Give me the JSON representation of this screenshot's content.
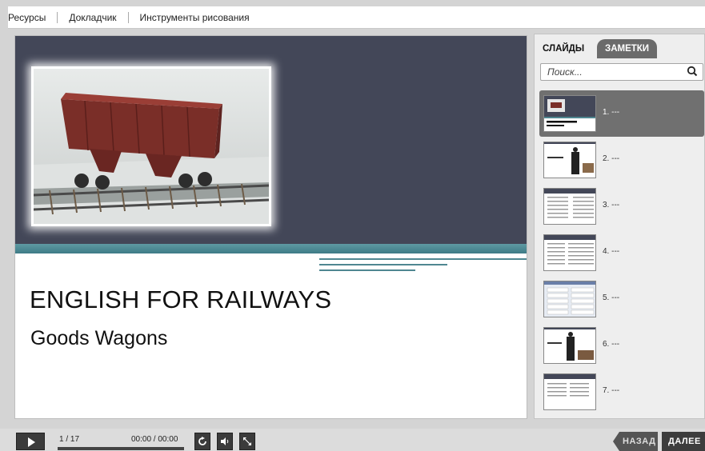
{
  "menu": {
    "items": [
      {
        "label": "Ресурсы"
      },
      {
        "label": "Докладчик"
      },
      {
        "label": "Инструменты рисования"
      }
    ]
  },
  "slide": {
    "title": "ENGLISH FOR RAILWAYS",
    "subtitle": "Goods Wagons"
  },
  "panel": {
    "tab_slides": "СЛАЙДЫ",
    "tab_notes": "ЗАМЕТКИ",
    "search_placeholder": "Поиск...",
    "slides": [
      {
        "label": "1. ---",
        "active": true
      },
      {
        "label": "2. ---"
      },
      {
        "label": "3. ---"
      },
      {
        "label": "4. ---"
      },
      {
        "label": "5. ---"
      },
      {
        "label": "6. ---"
      },
      {
        "label": "7. ---"
      }
    ]
  },
  "player": {
    "counter": "1 / 17",
    "time": "00:00 / 00:00",
    "prev_label": "НАЗАД",
    "next_label": "ДАЛЕЕ"
  },
  "colors": {
    "banner": "#434758",
    "teal": "#4f8791",
    "active_thumb": "#707070"
  }
}
